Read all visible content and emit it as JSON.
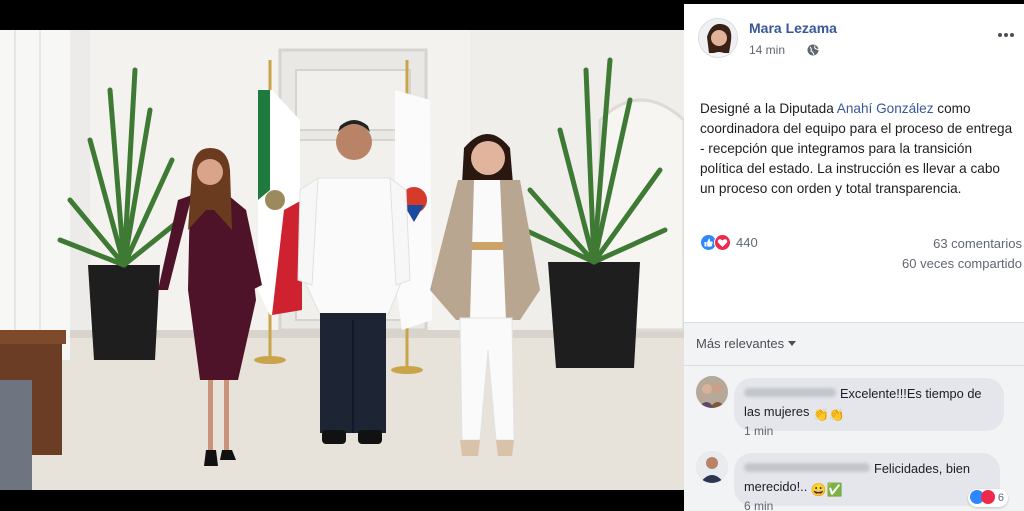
{
  "post": {
    "author": "Mara Lezama",
    "time": "14 min",
    "text_before": "Designé a la Diputada ",
    "mention": "Anahí González",
    "text_after": " como coordinadora del equipo para el proceso de entrega - recepción que integramos para la transición política del estado. La instrucción es llevar a cabo un proceso con orden y total transparencia.",
    "reactions_count": "440",
    "comments_count": "63 comentarios",
    "shares_count": "60 veces compartido"
  },
  "comments_section": {
    "sort_label": "Más relevantes",
    "comments": [
      {
        "text": "Excelente!!!Es tiempo de las mujeres",
        "emoji": "👏👏",
        "time": "1 min"
      },
      {
        "text": "Felicidades, bien merecido!..",
        "emoji": "😀✅",
        "time": "6 min",
        "reactions": "6"
      }
    ]
  },
  "colors": {
    "link": "#385898",
    "like": "#2d88ff",
    "love": "#f0284a",
    "comment_bg": "#f2f3f5",
    "bubble_bg": "#e4e6eb"
  },
  "icons": [
    "globe-icon",
    "more-options-icon",
    "like-reaction-icon",
    "love-reaction-icon",
    "sort-caret-icon"
  ]
}
